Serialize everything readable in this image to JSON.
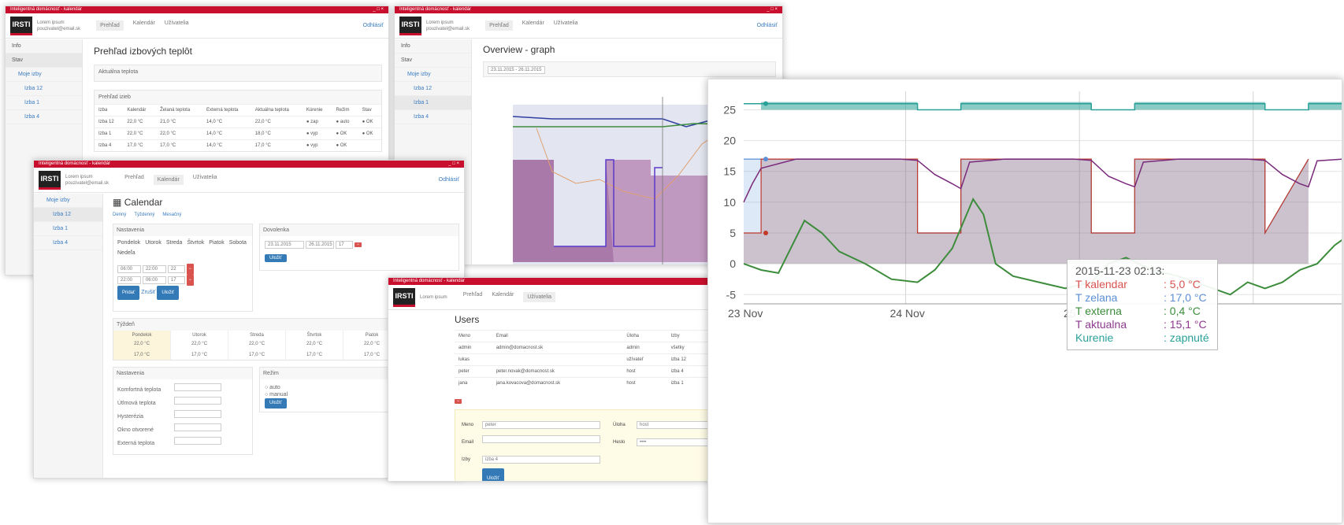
{
  "app": {
    "title_bar": "Inteligentná domácnosť - kalendár",
    "user_line1": "Lorem ipsum",
    "user_line2": "pouzivatel@email.sk",
    "logo": "IRSTI"
  },
  "nav": {
    "overview": "Prehľad",
    "calendar": "Kalendár",
    "users": "Užívatelia",
    "logout": "Odhlásiť"
  },
  "win1": {
    "sidebar": [
      "Info",
      "Stav",
      "Moje izby",
      "Izba 12",
      "Izba 1",
      "Izba 4"
    ],
    "title": "Prehľad izbových teplôt",
    "filter": "Aktuálna teplota",
    "panel_title": "Prehľad izieb",
    "columns": [
      "Izba",
      "Kalendár",
      "Želaná teplota",
      "Externá teplota",
      "Aktuálna teplota",
      "Kúrenie",
      "Režim",
      "Stav"
    ],
    "rows": [
      [
        "Izba 12",
        "22,0 °C",
        "21,0 °C",
        "14,0 °C",
        "22,0 °C",
        "● zap",
        "● auto",
        "● OK"
      ],
      [
        "Izba 1",
        "22,0 °C",
        "22,0 °C",
        "14,0 °C",
        "18,0 °C",
        "● vyp",
        "● OK",
        "● OK"
      ],
      [
        "Izba 4",
        "17,0 °C",
        "17,0 °C",
        "14,0 °C",
        "17,0 °C",
        "● vyp",
        "● OK",
        ""
      ]
    ],
    "row_button": "Detail"
  },
  "win2": {
    "sidebar": [
      "Info",
      "Stav",
      "Moje izby",
      "Izba 12",
      "Izba 1",
      "Izba 4"
    ],
    "title": "Overview - graph",
    "range": "23.11.2015 - 26.11.2015"
  },
  "win3": {
    "sidebar": [
      "Moje izby",
      "Izba 12",
      "Izba 1",
      "Izba 4"
    ],
    "title": "Calendar",
    "tabs": [
      "Denný",
      "Týždenný",
      "Mesačný"
    ],
    "panel_left": "Nastavenia",
    "panel_right": "Dovolenka",
    "days": [
      "Pondelok",
      "Utorok",
      "Streda",
      "Štvrtok",
      "Piatok",
      "Sobota",
      "Nedeľa"
    ],
    "week_title": "Týždeň",
    "week_days": [
      "Pondelok",
      "Utorok",
      "Streda",
      "Štvrtok",
      "Piatok",
      "Sobota"
    ],
    "slot1": "22,0 °C",
    "slot2": "17,0 °C",
    "settings_title": "Nastavenia",
    "settings": [
      "Komfortná teplota",
      "Útlmová teplota",
      "Hysterézia",
      "Okno otvorené",
      "Externá teplota"
    ],
    "other_title": "Režim",
    "save": "Uložiť",
    "add": "Pridať",
    "cancel": "Zrušiť"
  },
  "win4": {
    "title": "Users",
    "columns": [
      "Meno",
      "Email",
      "Úloha",
      "Izby",
      ""
    ],
    "rows": [
      [
        "admin",
        "admin@domacnost.sk",
        "admin",
        "všetky",
        ""
      ],
      [
        "lukas",
        "",
        "užívateľ",
        "izba 12",
        ""
      ],
      [
        "peter",
        "peter.novak@domacnost.sk",
        "host",
        "izba 4",
        "izba 12"
      ],
      [
        "jana",
        "jana.kovacova@domacnost.sk",
        "host",
        "izba 1",
        "izba 1"
      ]
    ],
    "form": {
      "name_label": "Meno",
      "role_label": "Úloha",
      "email_label": "Email",
      "pass_label": "Heslo",
      "room_label": "Izby",
      "save": "Uložiť"
    }
  },
  "chart_tooltip": {
    "date": "2015-11-23 02:13:",
    "rows": [
      {
        "label": "T kalendar",
        "value": ": 5,0 °C",
        "color": "#d9534f"
      },
      {
        "label": "T zelana",
        "value": ": 17,0 °C",
        "color": "#5b8fd6"
      },
      {
        "label": "T externa",
        "value": ": 0,4 °C",
        "color": "#3c8c3c"
      },
      {
        "label": "T aktualna",
        "value": ": 15,1 °C",
        "color": "#8e3a8e"
      },
      {
        "label": "Kurenie",
        "value": ": zapnuté",
        "color": "#2aa198"
      }
    ]
  },
  "chart_data": {
    "type": "line",
    "y_ticks": [
      "25",
      "20",
      "15",
      "10",
      "5",
      "0",
      "-5"
    ],
    "x_ticks": [
      "23 Nov",
      "24 Nov",
      "25 Nov"
    ],
    "ylim": [
      -6.5,
      28
    ],
    "series": [
      {
        "name": "T kalendar",
        "color": "#c0392b",
        "x": [
          0,
          0.1,
          0.1,
          1.0,
          1.0,
          1.25,
          1.25,
          2.0,
          2.0,
          2.25,
          2.25,
          3.0,
          3.0,
          3.25
        ],
        "values": [
          5,
          5,
          17,
          17,
          5,
          5,
          17,
          17,
          5,
          5,
          17,
          17,
          5,
          17
        ]
      },
      {
        "name": "T zelana",
        "color": "#5b8fd6",
        "x": [
          0,
          0.1,
          0.1,
          1.0,
          1.0,
          1.25,
          1.25,
          2.0,
          2.0,
          2.25,
          2.25,
          3.0,
          3.0,
          3.25
        ],
        "values": [
          17,
          17,
          17,
          17,
          5,
          5,
          17,
          17,
          5,
          5,
          17,
          17,
          5,
          17
        ]
      },
      {
        "name": "T aktualna",
        "color": "#7b2a7b",
        "x": [
          0,
          0.05,
          0.1,
          0.3,
          0.9,
          1.0,
          1.1,
          1.2,
          1.25,
          1.3,
          1.5,
          1.9,
          2.0,
          2.1,
          2.2,
          2.25,
          2.3,
          2.5,
          2.9,
          3.0,
          3.1,
          3.2,
          3.25,
          3.3,
          3.45
        ],
        "values": [
          10,
          13,
          15.5,
          17,
          17,
          16.8,
          14.5,
          13,
          12.2,
          16.5,
          17,
          17,
          16.8,
          14.2,
          13,
          12.5,
          16.5,
          17,
          17,
          16.8,
          14.5,
          13,
          12.5,
          16.7,
          17
        ]
      },
      {
        "name": "T externa",
        "color": "#3c8c3c",
        "x": [
          0,
          0.1,
          0.2,
          0.35,
          0.45,
          0.55,
          0.7,
          0.85,
          1.0,
          1.1,
          1.2,
          1.32,
          1.38,
          1.45,
          1.55,
          1.7,
          1.85,
          2.0,
          2.1,
          2.2,
          2.35,
          2.5,
          2.6,
          2.7,
          2.8,
          2.9,
          3.0,
          3.1,
          3.2,
          3.3,
          3.4,
          3.45
        ],
        "values": [
          0,
          -1,
          -1.5,
          7,
          5,
          2,
          0,
          -2.5,
          -3,
          -1,
          2.5,
          10.5,
          8,
          0,
          -2,
          -3,
          -4,
          -3,
          0,
          1,
          -1,
          -2,
          -3,
          -4,
          -5,
          -3,
          -4,
          -3,
          -1,
          0,
          3,
          4
        ]
      },
      {
        "name": "Kurenie",
        "color": "#2aa198",
        "x": [
          0,
          0.1,
          0.1,
          1.0,
          1.0,
          1.25,
          1.25,
          2.0,
          2.0,
          2.25,
          2.25,
          3.0,
          3.0,
          3.25,
          3.25,
          3.45
        ],
        "values": [
          26,
          26,
          26,
          26,
          25,
          25,
          26,
          26,
          25,
          25,
          26,
          26,
          25,
          25,
          26,
          26
        ]
      }
    ]
  }
}
